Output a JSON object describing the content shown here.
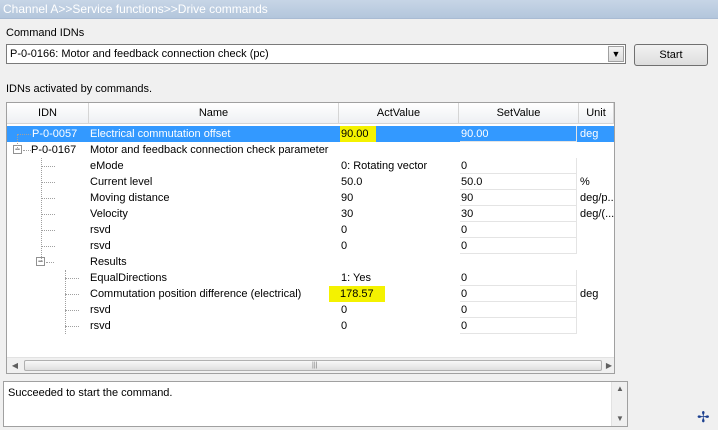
{
  "breadcrumb": "Channel A>>Service functions>>Drive commands",
  "command_label": "Command IDNs",
  "command_value": "P-0-0166: Motor and feedback connection check (pc)",
  "start_label": "Start",
  "list_label": "IDNs activated by commands.",
  "columns": {
    "idn": "IDN",
    "name": "Name",
    "act": "ActValue",
    "set": "SetValue",
    "unit": "Unit"
  },
  "rows": [
    {
      "idn": "P-0-0057",
      "name": "Electrical commutation offset",
      "act": "90.00",
      "set": "90.00",
      "unit": "deg",
      "selected": true,
      "highlight": true
    },
    {
      "idn": "P-0-0167",
      "name": "Motor and feedback connection check parameter",
      "act": "",
      "set": "",
      "unit": "",
      "expander": "-"
    },
    {
      "name": "eMode",
      "act": "0: Rotating vector",
      "set": "0",
      "unit": ""
    },
    {
      "name": "Current level",
      "act": "50.0",
      "set": "50.0",
      "unit": "%"
    },
    {
      "name": "Moving distance",
      "act": "90",
      "set": "90",
      "unit": "deg/p..."
    },
    {
      "name": "Velocity",
      "act": "30",
      "set": "30",
      "unit": "deg/(..."
    },
    {
      "name": "rsvd",
      "act": "0",
      "set": "0",
      "unit": ""
    },
    {
      "name": "rsvd",
      "act": "0",
      "set": "0",
      "unit": ""
    },
    {
      "name": "Results",
      "act": "",
      "set": "",
      "unit": "",
      "expander": "-"
    },
    {
      "name": "EqualDirections",
      "act": "1: Yes",
      "set": "0",
      "unit": ""
    },
    {
      "name": "Commutation position difference (electrical)",
      "act": "178.57",
      "set": "0",
      "unit": "deg",
      "highlight": true
    },
    {
      "name": "rsvd",
      "act": "0",
      "set": "0",
      "unit": ""
    },
    {
      "name": "rsvd",
      "act": "0",
      "set": "0",
      "unit": ""
    }
  ],
  "status_message": "Succeeded to start the command.",
  "icons": {
    "combo": "chevron-down-icon",
    "scroll_left": "arrow-left-icon",
    "scroll_right": "arrow-right-icon",
    "move": "move-cursor-icon"
  }
}
